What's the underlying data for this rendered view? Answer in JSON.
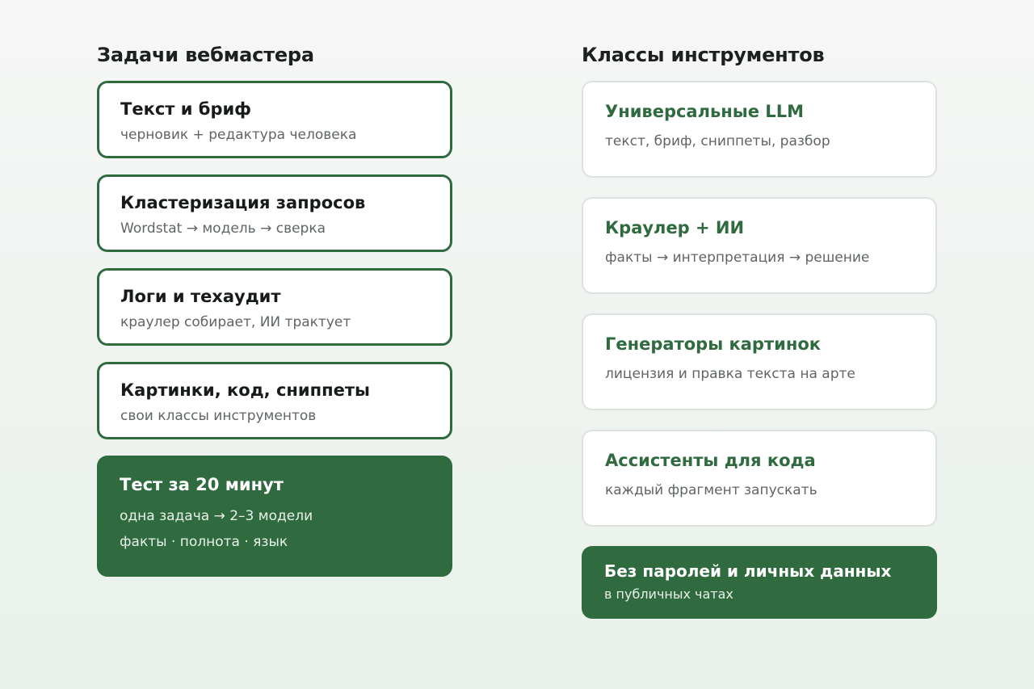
{
  "left": {
    "title": "Задачи вебмастера",
    "tasks": [
      {
        "title": "Текст и бриф",
        "subtitle": "черновик + редактура человека"
      },
      {
        "title": "Кластеризация запросов",
        "subtitle": "Wordstat → модель → сверка"
      },
      {
        "title": "Логи и техаудит",
        "subtitle": "краулер собирает, ИИ трактует"
      },
      {
        "title": "Картинки, код, сниппеты",
        "subtitle": "свои классы инструментов"
      }
    ],
    "test": {
      "title": "Тест за 20 минут",
      "line1": "одна задача → 2–3 модели",
      "line2": "факты · полнота · язык"
    }
  },
  "right": {
    "title": "Классы инструментов",
    "tools": [
      {
        "title": "Универсальные LLM",
        "subtitle": "текст, бриф, сниппеты, разбор"
      },
      {
        "title": "Краулер + ИИ",
        "subtitle": "факты → интерпретация → решение"
      },
      {
        "title": "Генераторы картинок",
        "subtitle": "лицензия и правка текста на арте"
      },
      {
        "title": "Ассистенты для кода",
        "subtitle": "каждый фрагмент запускать"
      }
    ],
    "privacy": {
      "title": "Без паролей и личных данных",
      "subtitle": "в публичных чатах"
    }
  },
  "colors": {
    "accent": "#2f6b3e",
    "card_border": "#dde2de",
    "text_dark": "#181c19",
    "text_muted": "#5f6661"
  }
}
